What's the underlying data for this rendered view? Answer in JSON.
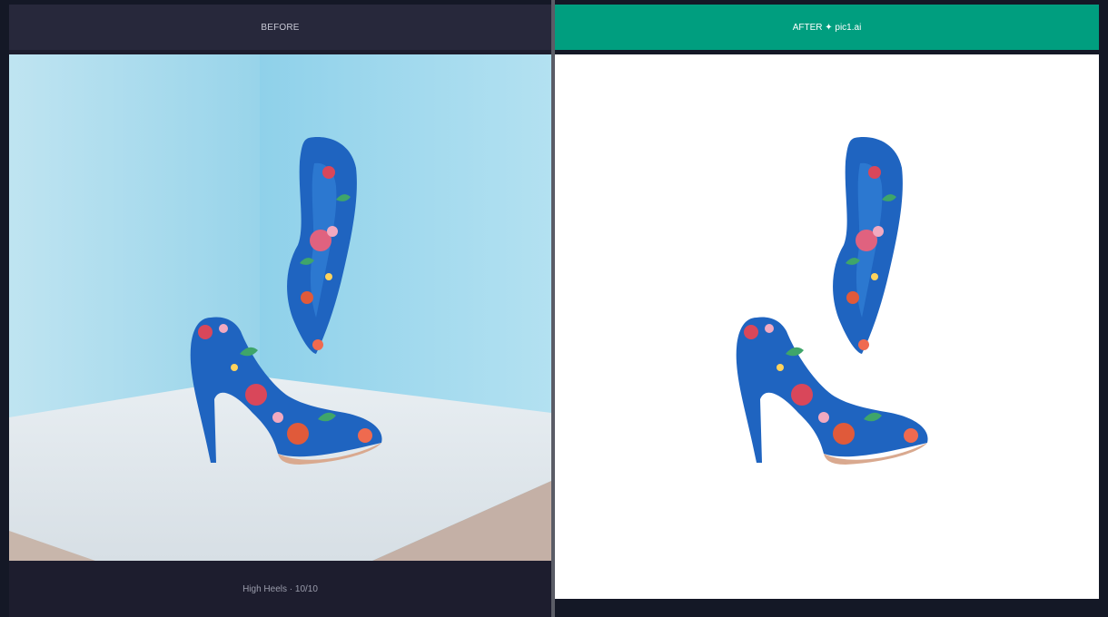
{
  "before_panel": {
    "header_label": "BEFORE",
    "caption": "High Heels · 10/10"
  },
  "after_panel": {
    "header_label": "AFTER ✦ pic1.ai"
  },
  "colors": {
    "page_background": "#141826",
    "before_header": "#27283b",
    "after_header": "#009e7f",
    "divider": "#5a5c66",
    "shoe_blue": "#1f64c0"
  }
}
